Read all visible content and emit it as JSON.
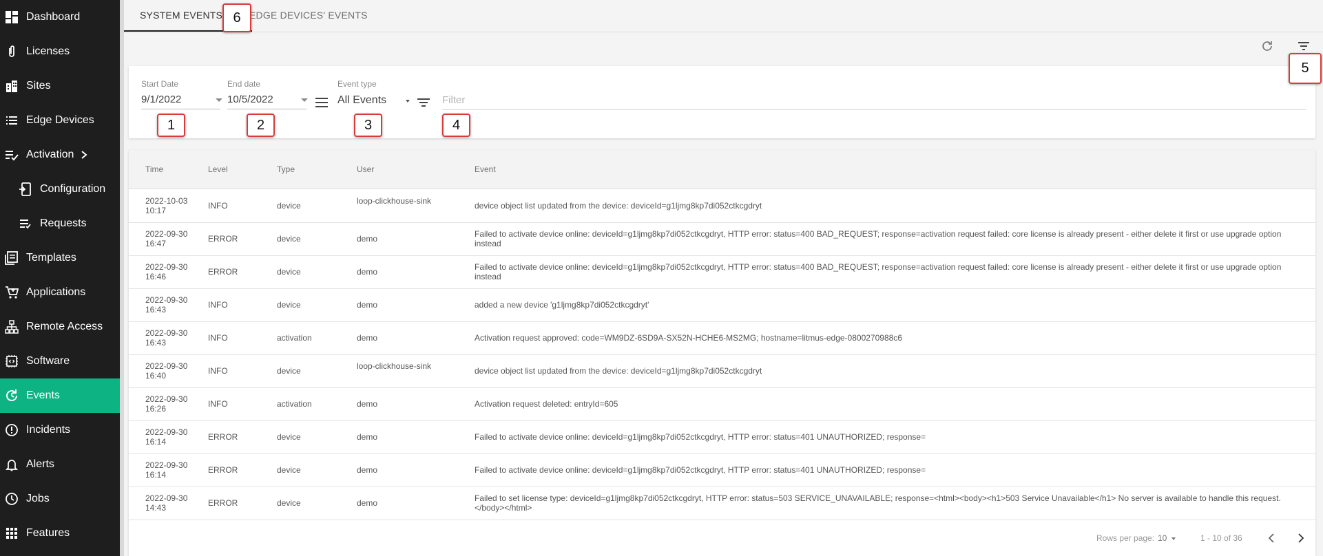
{
  "sidebar": {
    "items": [
      {
        "label": "Dashboard",
        "icon": "dashboard-icon"
      },
      {
        "label": "Licenses",
        "icon": "paperclip-icon"
      },
      {
        "label": "Sites",
        "icon": "building-icon"
      },
      {
        "label": "Edge Devices",
        "icon": "list-icon"
      },
      {
        "label": "Activation",
        "icon": "checklist-icon"
      },
      {
        "label": "Configuration",
        "icon": "config-icon"
      },
      {
        "label": "Requests",
        "icon": "list-check-icon"
      },
      {
        "label": "Templates",
        "icon": "template-icon"
      },
      {
        "label": "Applications",
        "icon": "cart-icon"
      },
      {
        "label": "Remote Access",
        "icon": "network-icon"
      },
      {
        "label": "Software",
        "icon": "chip-icon"
      },
      {
        "label": "Events",
        "icon": "events-icon"
      },
      {
        "label": "Incidents",
        "icon": "alert-circle-icon"
      },
      {
        "label": "Alerts",
        "icon": "bell-icon"
      },
      {
        "label": "Jobs",
        "icon": "clock-icon"
      },
      {
        "label": "Features",
        "icon": "grid-icon"
      }
    ],
    "active": "Events"
  },
  "tabs": [
    "SYSTEM EVENTS",
    "EDGE DEVICES' EVENTS"
  ],
  "markers": [
    "1",
    "2",
    "3",
    "4",
    "5",
    "6"
  ],
  "filters": {
    "start_label": "Start Date",
    "start_value": "9/1/2022",
    "end_label": "End date",
    "end_value": "10/5/2022",
    "type_label": "Event type",
    "type_value": "All Events",
    "filter_placeholder": "Filter"
  },
  "table": {
    "headers": [
      "Time",
      "Level",
      "Type",
      "User",
      "Event"
    ],
    "rows": [
      {
        "time": "2022-10-03 10:17",
        "level": "INFO",
        "type": "device",
        "user": "loop-clickhouse-sink",
        "event": "device object list updated from the device: deviceId=g1ljmg8kp7di052ctkcgdryt"
      },
      {
        "time": "2022-09-30 16:47",
        "level": "ERROR",
        "type": "device",
        "user": "demo",
        "event": "Failed to activate device online: deviceId=g1ljmg8kp7di052ctkcgdryt, HTTP error: status=400 BAD_REQUEST; response=activation request failed: core license is already present - either delete it first or use upgrade option instead"
      },
      {
        "time": "2022-09-30 16:46",
        "level": "ERROR",
        "type": "device",
        "user": "demo",
        "event": "Failed to activate device online: deviceId=g1ljmg8kp7di052ctkcgdryt, HTTP error: status=400 BAD_REQUEST; response=activation request failed: core license is already present - either delete it first or use upgrade option instead"
      },
      {
        "time": "2022-09-30 16:43",
        "level": "INFO",
        "type": "device",
        "user": "demo",
        "event": "added a new device 'g1ljmg8kp7di052ctkcgdryt'"
      },
      {
        "time": "2022-09-30 16:43",
        "level": "INFO",
        "type": "activation",
        "user": "demo",
        "event": "Activation request approved: code=WM9DZ-6SD9A-SX52N-HCHE6-MS2MG; hostname=litmus-edge-0800270988c6"
      },
      {
        "time": "2022-09-30 16:40",
        "level": "INFO",
        "type": "device",
        "user": "loop-clickhouse-sink",
        "event": "device object list updated from the device: deviceId=g1ljmg8kp7di052ctkcgdryt"
      },
      {
        "time": "2022-09-30 16:26",
        "level": "INFO",
        "type": "activation",
        "user": "demo",
        "event": "Activation request deleted: entryId=605"
      },
      {
        "time": "2022-09-30 16:14",
        "level": "ERROR",
        "type": "device",
        "user": "demo",
        "event": "Failed to activate device online: deviceId=g1ljmg8kp7di052ctkcgdryt, HTTP error: status=401 UNAUTHORIZED; response="
      },
      {
        "time": "2022-09-30 16:14",
        "level": "ERROR",
        "type": "device",
        "user": "demo",
        "event": "Failed to activate device online: deviceId=g1ljmg8kp7di052ctkcgdryt, HTTP error: status=401 UNAUTHORIZED; response="
      },
      {
        "time": "2022-09-30 14:43",
        "level": "ERROR",
        "type": "device",
        "user": "demo",
        "event": "Failed to set license type: deviceId=g1ljmg8kp7di052ctkcgdryt, HTTP error: status=503 SERVICE_UNAVAILABLE; response=<html><body><h1>503 Service Unavailable</h1> No server is available to handle this request. </body></html>"
      }
    ]
  },
  "pagination": {
    "rows_per_page_label": "Rows per page:",
    "rows_per_page": "10",
    "range": "1 - 10 of 36"
  },
  "colors": {
    "sidebar_bg": "#1e1e1e",
    "active": "#0db383",
    "marker_border": "#d93b3b"
  }
}
